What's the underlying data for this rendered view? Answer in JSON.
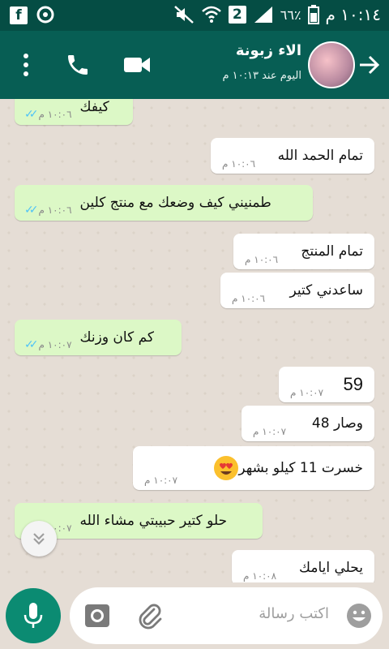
{
  "status_bar": {
    "time": "١٠:١٤ م",
    "battery": "٦٦٪",
    "sim_badge": "2"
  },
  "header": {
    "contact_name": "الاء زبونة",
    "last_seen": "اليوم عند ١٠:١٣ م"
  },
  "messages": [
    {
      "dir": "out",
      "text": "كيفك",
      "time": "١٠:٠٦ م",
      "ticks": "✓✓"
    },
    {
      "dir": "in",
      "text": "تمام الحمد الله",
      "time": "١٠:٠٦ م"
    },
    {
      "dir": "out",
      "text": "طمنيني كيف وضعك مع منتج كلين",
      "time": "١٠:٠٦ م",
      "ticks": "✓✓"
    },
    {
      "dir": "in",
      "text": "تمام المنتج",
      "time": "١٠:٠٦ م"
    },
    {
      "dir": "in",
      "text": "ساعدني كتير",
      "time": "١٠:٠٦ م"
    },
    {
      "dir": "out",
      "text": "كم كان وزنك",
      "time": "١٠:٠٧ م",
      "ticks": "✓✓"
    },
    {
      "dir": "in",
      "text": "59",
      "time": "١٠:٠٧ م"
    },
    {
      "dir": "in",
      "text": "وصار 48",
      "time": "١٠:٠٧ م"
    },
    {
      "dir": "in",
      "text": "خسرت 11 كيلو بشهر",
      "time": "١٠:٠٧ م",
      "emoji": "heart-eyes-emoji"
    },
    {
      "dir": "out",
      "text": "حلو كتير حبيبتي مشاء الله",
      "time": "١٠:٠٧ م",
      "ticks": "✓✓"
    },
    {
      "dir": "in",
      "text": "يحلي ايامك",
      "time": "١٠:٠٨ م"
    }
  ],
  "composer": {
    "placeholder": "اكتب رسالة"
  },
  "colors": {
    "header": "#075e54",
    "status_bar": "#054d44",
    "outgoing_bubble": "#dcf8c6",
    "incoming_bubble": "#ffffff",
    "chat_background": "#e5ddd5",
    "mic_button": "#0b8b72",
    "read_ticks": "#4fc3f7"
  },
  "icons": [
    "facebook-icon",
    "messenger-icon",
    "mute-icon",
    "wifi-icon",
    "signal-icon",
    "battery-icon",
    "back-arrow-icon",
    "menu-dots-icon",
    "phone-icon",
    "video-icon",
    "mic-icon",
    "camera-icon",
    "attach-icon",
    "emoji-icon",
    "chevron-double-down-icon"
  ]
}
